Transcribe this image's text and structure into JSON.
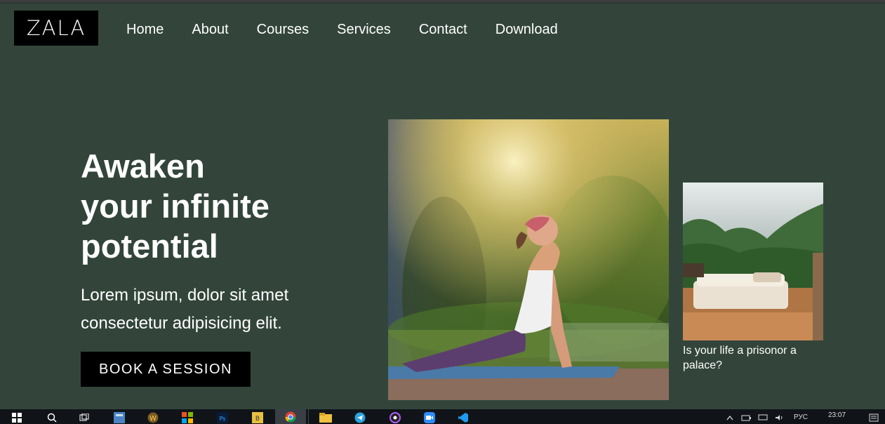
{
  "header": {
    "logo": "ZALA",
    "nav": [
      "Home",
      "About",
      "Courses",
      "Services",
      "Contact",
      "Download"
    ]
  },
  "hero": {
    "title_lines": [
      "Awaken",
      "your infinite",
      "potential"
    ],
    "subtitle_lines": [
      "Lorem ipsum, dolor sit amet",
      "consectetur adipisicing elit."
    ],
    "cta": "BOOK A SESSION"
  },
  "gallery": {
    "main_image": "yoga-pose-photo",
    "side_image": "forest-bedroom-photo",
    "side_caption": "Is your life a prisonor a palace?"
  },
  "taskbar": {
    "apps": [
      "windows-start-icon",
      "search-icon",
      "task-view-icon",
      "calculator-icon",
      "world-of-warcraft-icon",
      "store-icon",
      "photoshop-icon",
      "game-icon",
      "chrome-icon",
      "file-explorer-icon",
      "telegram-icon",
      "app-icon",
      "zoom-icon",
      "vscode-icon"
    ],
    "lang": "РУС",
    "time": "23:07"
  },
  "colors": {
    "background": "#33453b",
    "logo_bg": "#000000",
    "button_bg": "#000000",
    "text": "#ffffff"
  }
}
